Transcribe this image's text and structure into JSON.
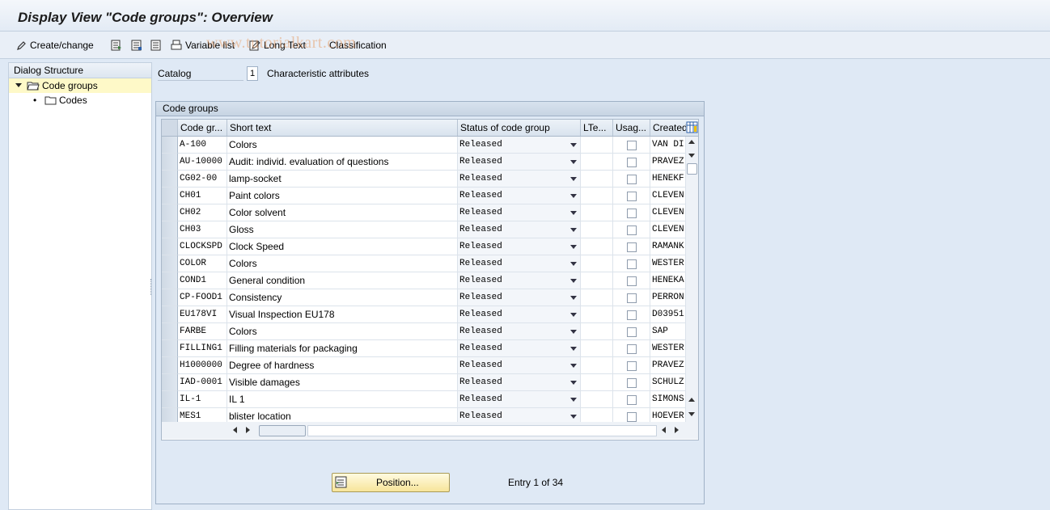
{
  "window": {
    "title": "Display View \"Code groups\": Overview"
  },
  "toolbar": {
    "create_change": "Create/change",
    "variable_list": "Variable list",
    "long_text": "Long Text",
    "classification": "Classification"
  },
  "watermark": "www.tutorialkart.com",
  "dialog_structure": {
    "title": "Dialog Structure",
    "items": [
      {
        "label": "Code groups",
        "selected": true
      },
      {
        "label": "Codes",
        "selected": false
      }
    ]
  },
  "catalog": {
    "label": "Catalog",
    "value": "1",
    "description": "Characteristic attributes"
  },
  "code_groups": {
    "title": "Code groups",
    "columns": [
      "Code gr...",
      "Short text",
      "Status of code group",
      "LTe...",
      "Usag...",
      "Created"
    ],
    "rows": [
      {
        "code": "A-100",
        "text": "Colors",
        "status": "Released",
        "created": "VAN DI"
      },
      {
        "code": "AU-10000",
        "text": "Audit: individ. evaluation of questions",
        "status": "Released",
        "created": "PRAVEZ"
      },
      {
        "code": "CG02-00",
        "text": "lamp-socket",
        "status": "Released",
        "created": "HENEKF"
      },
      {
        "code": "CH01",
        "text": "Paint colors",
        "status": "Released",
        "created": "CLEVEN"
      },
      {
        "code": "CH02",
        "text": "Color solvent",
        "status": "Released",
        "created": "CLEVEN"
      },
      {
        "code": "CH03",
        "text": "Gloss",
        "status": "Released",
        "created": "CLEVEN"
      },
      {
        "code": "CLOCKSPD",
        "text": "Clock Speed",
        "status": "Released",
        "created": "RAMANK"
      },
      {
        "code": "COLOR",
        "text": "Colors",
        "status": "Released",
        "created": "WESTER"
      },
      {
        "code": "COND1",
        "text": "General condition",
        "status": "Released",
        "created": "HENEKA"
      },
      {
        "code": "CP-FOOD1",
        "text": "Consistency",
        "status": "Released",
        "created": "PERRON"
      },
      {
        "code": "EU178VI",
        "text": "Visual Inspection EU178",
        "status": "Released",
        "created": "D03951"
      },
      {
        "code": "FARBE",
        "text": "Colors",
        "status": "Released",
        "created": "SAP"
      },
      {
        "code": "FILLING1",
        "text": "Filling materials for packaging",
        "status": "Released",
        "created": "WESTER"
      },
      {
        "code": "H1000000",
        "text": "Degree of hardness",
        "status": "Released",
        "created": "PRAVEZ"
      },
      {
        "code": "IAD-0001",
        "text": "Visible damages",
        "status": "Released",
        "created": "SCHULZ"
      },
      {
        "code": "IL-1",
        "text": "IL 1",
        "status": "Released",
        "created": "SIMONS"
      },
      {
        "code": "MES1",
        "text": "blister location",
        "status": "Released",
        "created": "HOEVER"
      }
    ]
  },
  "footer": {
    "position_button": "Position...",
    "entry_text": "Entry 1 of 34"
  }
}
